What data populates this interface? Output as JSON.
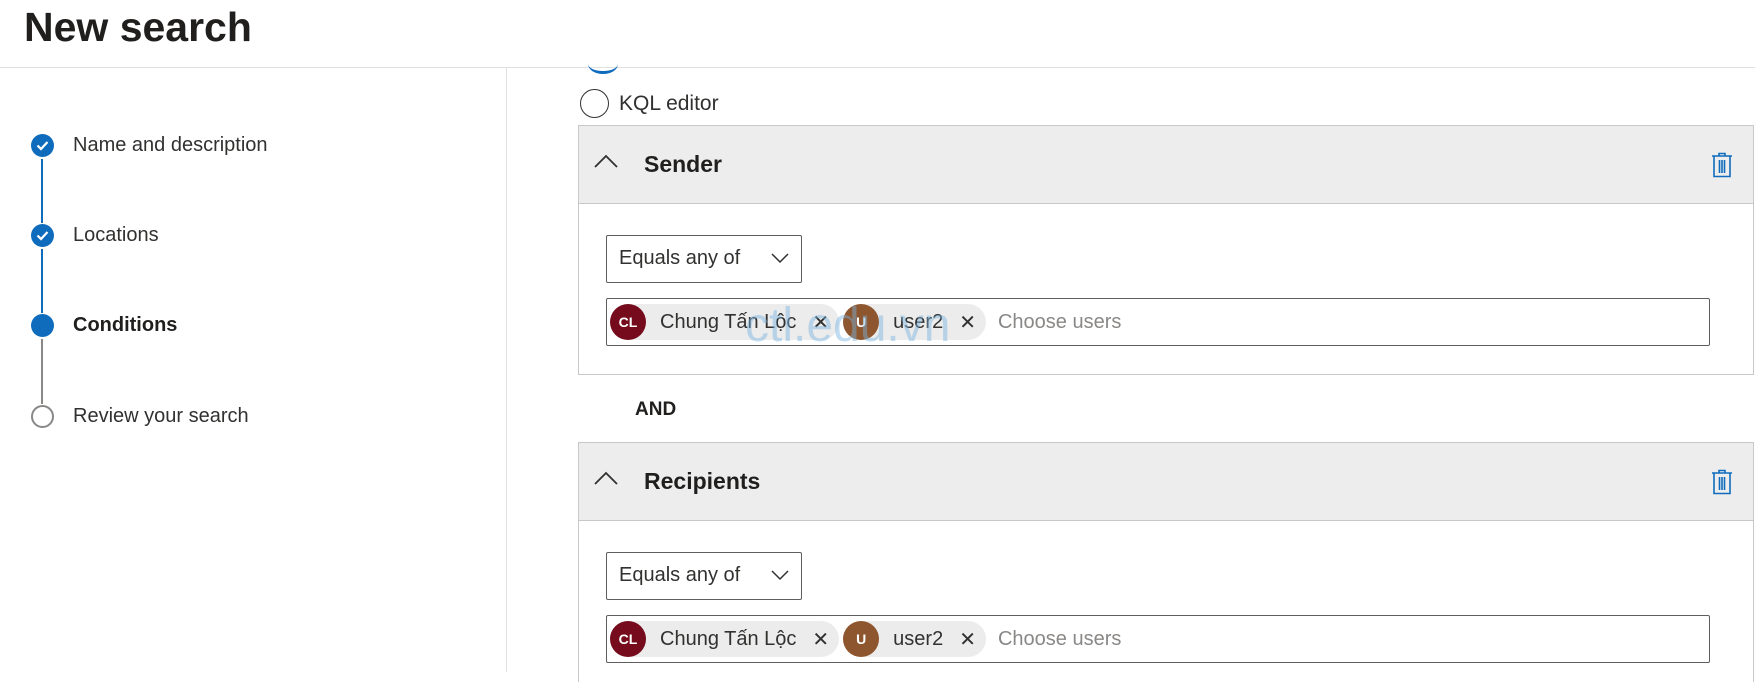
{
  "header": {
    "title": "New search"
  },
  "steps": [
    {
      "label": "Name and description",
      "state": "completed"
    },
    {
      "label": "Locations",
      "state": "completed"
    },
    {
      "label": "Conditions",
      "state": "current"
    },
    {
      "label": "Review your search",
      "state": "pending"
    }
  ],
  "query_mode": {
    "kql_label": "KQL editor",
    "kql_selected": false
  },
  "conditions": [
    {
      "title": "Sender",
      "operator": "Equals any of",
      "users": [
        {
          "initials": "CL",
          "name": "Chung Tấn Lộc",
          "color": "#750b1c"
        },
        {
          "initials": "U",
          "name": "user2",
          "color": "#8e562e"
        }
      ],
      "placeholder": "Choose users"
    },
    {
      "title": "Recipients",
      "operator": "Equals any of",
      "users": [
        {
          "initials": "CL",
          "name": "Chung Tấn Lộc",
          "color": "#750b1c"
        },
        {
          "initials": "U",
          "name": "user2",
          "color": "#8e562e"
        }
      ],
      "placeholder": "Choose users"
    }
  ],
  "connector": "AND",
  "watermark": "ctl.edu.vn",
  "colors": {
    "accent": "#0f6cbd"
  }
}
